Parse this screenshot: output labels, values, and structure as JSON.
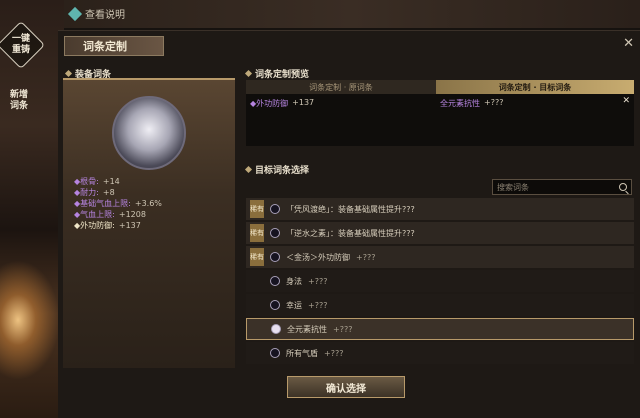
{
  "header": {
    "help_label": "查看说明"
  },
  "side": {
    "reset_label": "一键重铸",
    "add_label": "新增词条"
  },
  "dialog": {
    "title": "词条定制",
    "close": "✕"
  },
  "equip": {
    "section_label": "装备词条",
    "stats": [
      {
        "name": "根骨",
        "value": "+14"
      },
      {
        "name": "耐力",
        "value": "+8"
      },
      {
        "name": "基础气血上限",
        "value": "+3.6%"
      },
      {
        "name": "气血上限",
        "value": "+1208"
      },
      {
        "name": "外功防御",
        "value": "+137"
      }
    ]
  },
  "preview": {
    "section_label": "词条定制预览",
    "col_original": "词条定制 · 原词条",
    "col_target": "词条定制 · 目标词条",
    "original_name": "外功防御",
    "original_value": "+137",
    "target_name": "全元素抗性",
    "target_value": "+???",
    "remove": "✕"
  },
  "target": {
    "section_label": "目标词条选择",
    "search_placeholder": "搜索词条",
    "items": [
      {
        "tag": "稀有",
        "name": "「凭风渡绝」：装备基础属性提升???",
        "value": ""
      },
      {
        "tag": "稀有",
        "name": "「逆水之素」：装备基础属性提升???",
        "value": ""
      },
      {
        "tag": "稀有",
        "name": "＜金汤＞外功防御",
        "value": "+???"
      },
      {
        "tag": "",
        "name": "身法",
        "value": "+???"
      },
      {
        "tag": "",
        "name": "幸运",
        "value": "+???"
      },
      {
        "tag": "",
        "name": "全元素抗性",
        "value": "+???"
      },
      {
        "tag": "",
        "name": "所有气盾",
        "value": "+???"
      }
    ]
  },
  "confirm_label": "确认选择"
}
